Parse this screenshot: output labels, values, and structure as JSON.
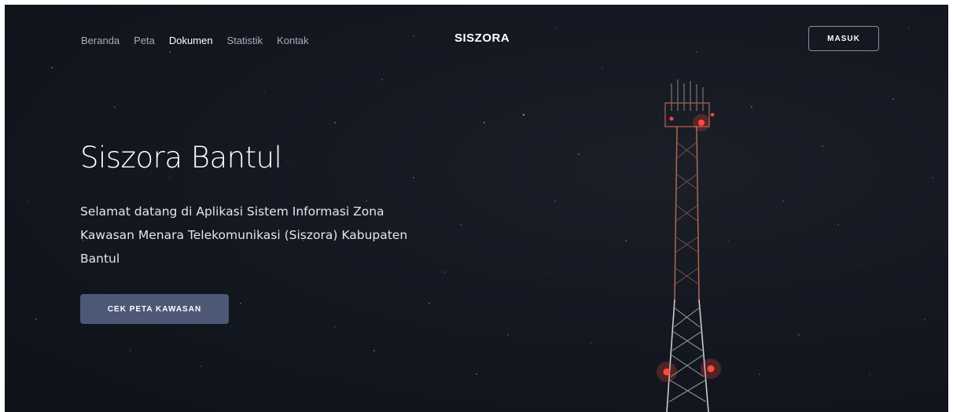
{
  "nav": {
    "items": [
      {
        "label": "Beranda",
        "active": false
      },
      {
        "label": "Peta",
        "active": false
      },
      {
        "label": "Dokumen",
        "active": true
      },
      {
        "label": "Statistik",
        "active": false
      },
      {
        "label": "Kontak",
        "active": false
      }
    ]
  },
  "brand": {
    "name": "SISZORA"
  },
  "header": {
    "login_label": "MASUK"
  },
  "hero": {
    "title": "Siszora Bantul",
    "description": "Selamat datang di Aplikasi Sistem Informasi Zona Kawasan Menara Telekomunikasi (Siszora) Kabupaten Bantul",
    "cta_label": "CEK PETA KAWASAN"
  },
  "colors": {
    "background": "#141821",
    "cta": "#4c5875",
    "tower_light": "#ff4a3d"
  },
  "images": {
    "hero_background": "night-sky-telecom-tower"
  }
}
